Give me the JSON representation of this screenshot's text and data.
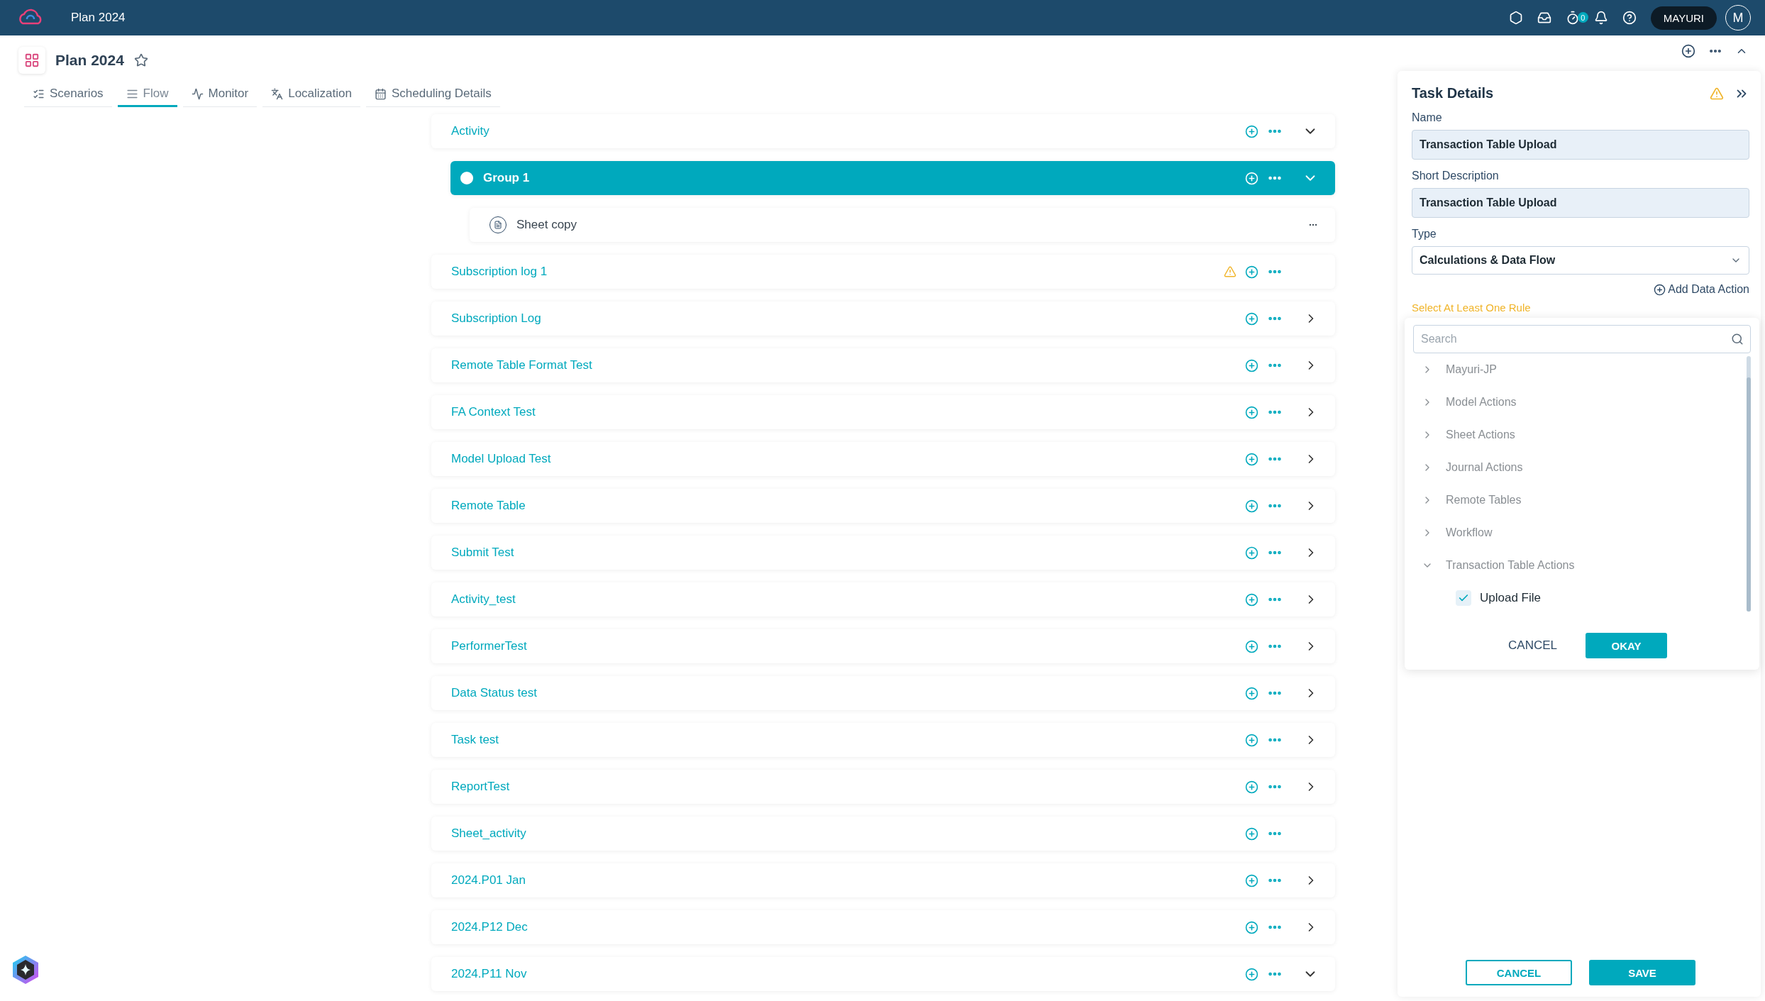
{
  "top_bar": {
    "title": "Plan 2024",
    "timer_badge": "0",
    "user": "MAYURI",
    "avatar": "M"
  },
  "page_header": {
    "title": "Plan 2024",
    "starred": false
  },
  "tabs": [
    {
      "label": "Scenarios",
      "selected": false
    },
    {
      "label": "Flow",
      "selected": true
    },
    {
      "label": "Monitor",
      "selected": false
    },
    {
      "label": "Localization",
      "selected": false
    },
    {
      "label": "Scheduling Details",
      "selected": false
    }
  ],
  "flow": [
    {
      "kind": "activity",
      "label": "Activity",
      "selected": false,
      "warning": false,
      "expanded": true,
      "children": [
        {
          "kind": "group",
          "label": "Group 1",
          "selected": true,
          "warning": false,
          "expanded": true,
          "children": [
            {
              "kind": "task",
              "label": "Sheet copy",
              "selected": false,
              "warning": false
            }
          ]
        }
      ]
    },
    {
      "kind": "activity",
      "label": "Subscription log 1",
      "selected": false,
      "warning": true
    },
    {
      "kind": "activity",
      "label": "Subscription Log",
      "selected": false,
      "warning": false,
      "expanded": false
    },
    {
      "kind": "activity",
      "label": "Remote Table Format Test",
      "selected": false,
      "warning": false,
      "expanded": false
    },
    {
      "kind": "activity",
      "label": "FA Context Test",
      "selected": false,
      "warning": false,
      "expanded": false
    },
    {
      "kind": "activity",
      "label": "Model Upload Test",
      "selected": false,
      "warning": false,
      "expanded": false
    },
    {
      "kind": "activity",
      "label": "Remote Table",
      "selected": false,
      "warning": false,
      "expanded": false
    },
    {
      "kind": "activity",
      "label": "Submit Test",
      "selected": false,
      "warning": false,
      "expanded": false
    },
    {
      "kind": "activity",
      "label": "Activity_test",
      "selected": false,
      "warning": false,
      "expanded": false
    },
    {
      "kind": "activity",
      "label": "PerformerTest",
      "selected": false,
      "warning": false,
      "expanded": false
    },
    {
      "kind": "activity",
      "label": "Data Status test",
      "selected": false,
      "warning": false,
      "expanded": false
    },
    {
      "kind": "activity",
      "label": "Task test",
      "selected": false,
      "warning": false,
      "expanded": false
    },
    {
      "kind": "activity",
      "label": "ReportTest",
      "selected": false,
      "warning": false,
      "expanded": false
    },
    {
      "kind": "activity",
      "label": "Sheet_activity",
      "selected": false,
      "warning": false
    },
    {
      "kind": "activity",
      "label": "2024.P01 Jan",
      "selected": false,
      "warning": false,
      "expanded": false
    },
    {
      "kind": "activity",
      "label": "2024.P12 Dec",
      "selected": false,
      "warning": false,
      "expanded": false
    },
    {
      "kind": "activity",
      "label": "2024.P11 Nov",
      "selected": false,
      "warning": false,
      "expanded": true
    }
  ],
  "task_details": {
    "title": "Task Details",
    "warning": true,
    "fields": [
      {
        "label": "Name",
        "value": "Transaction Table Upload"
      },
      {
        "label": "Short Description",
        "value": "Transaction Table Upload"
      }
    ],
    "type": {
      "label": "Type",
      "value": "Calculations & Data Flow"
    },
    "add_data_action": "Add Data Action",
    "validation": "Select At Least One Rule",
    "buttons": [
      "CANCEL",
      "SAVE"
    ]
  },
  "rule_picker": {
    "search": {
      "placeholder": "Search"
    },
    "items": [
      {
        "label": "Mayuri-JP",
        "expanded": false
      },
      {
        "label": "Model Actions",
        "expanded": false
      },
      {
        "label": "Sheet Actions",
        "expanded": false
      },
      {
        "label": "Journal Actions",
        "expanded": false
      },
      {
        "label": "Remote Tables",
        "expanded": false
      },
      {
        "label": "Workflow",
        "expanded": false
      },
      {
        "label": "Transaction Table Actions",
        "expanded": true,
        "children": [
          {
            "label": "Upload File",
            "checked": true
          }
        ]
      }
    ],
    "buttons": [
      "CANCEL",
      "OKAY"
    ]
  }
}
